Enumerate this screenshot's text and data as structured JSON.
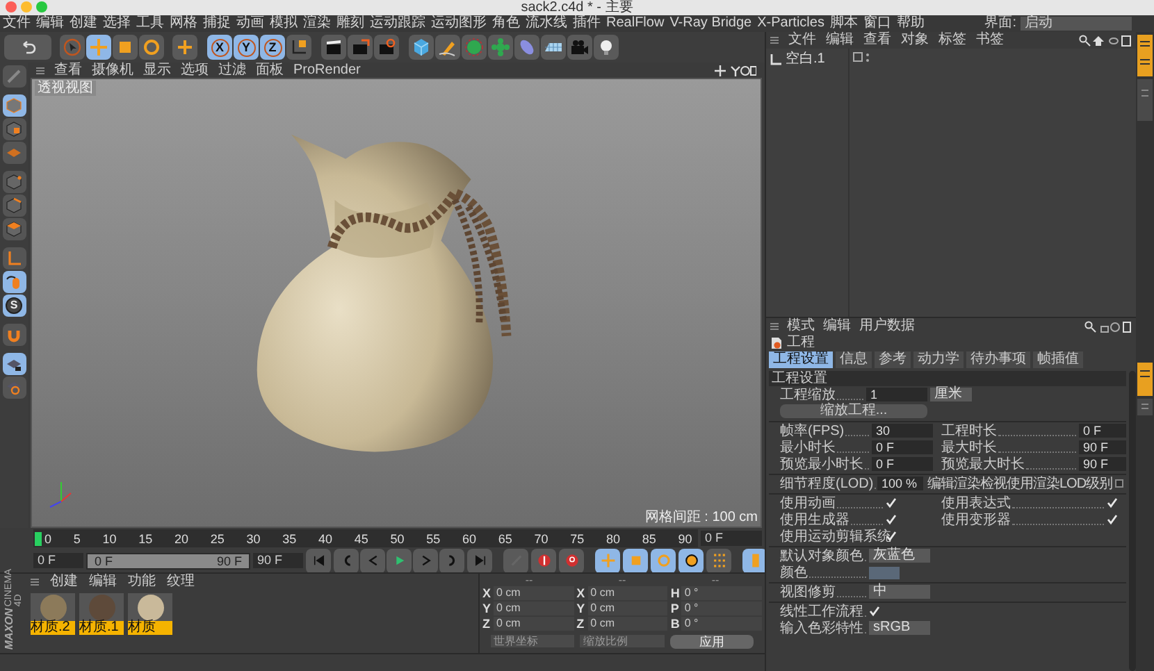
{
  "window": {
    "title": "sack2.c4d * - 主要"
  },
  "menu": [
    "文件",
    "编辑",
    "创建",
    "选择",
    "工具",
    "网格",
    "捕捉",
    "动画",
    "模拟",
    "渲染",
    "雕刻",
    "运动跟踪",
    "运动图形",
    "角色",
    "流水线",
    "插件",
    "RealFlow",
    "V-Ray Bridge",
    "X-Particles",
    "脚本",
    "窗口",
    "帮助"
  ],
  "layout": {
    "label": "界面:",
    "value": "启动"
  },
  "toolbar": {
    "axis_buttons": [
      {
        "label": "X",
        "selected": true
      },
      {
        "label": "Y",
        "selected": true
      },
      {
        "label": "Z",
        "selected": true
      }
    ]
  },
  "left_toolbar": {
    "snap_label": "S"
  },
  "viewport": {
    "menu": [
      "查看",
      "摄像机",
      "显示",
      "选项",
      "过滤",
      "面板",
      "ProRender"
    ],
    "label": "透视视图",
    "grid_spacing": "网格间距 : 100 cm"
  },
  "timeline": {
    "ticks": [
      "0",
      "5",
      "10",
      "15",
      "20",
      "25",
      "30",
      "35",
      "40",
      "45",
      "50",
      "55",
      "60",
      "65",
      "70",
      "75",
      "80",
      "85",
      "90"
    ],
    "current_frame": "0 F",
    "start": "0 F",
    "range": {
      "start": "0 F",
      "end": "90 F",
      "level": 1
    },
    "end": "90 F"
  },
  "materials": {
    "menu": [
      "创建",
      "编辑",
      "功能",
      "纹理"
    ],
    "items": [
      {
        "name": "材质.2",
        "color": "#8c7a5a"
      },
      {
        "name": "材质.1",
        "color": "#5e4a3a"
      },
      {
        "name": "材质",
        "color": "#c9b99a"
      }
    ]
  },
  "brand": [
    "MAXON",
    "CINEMA 4D"
  ],
  "coordinates": {
    "headers": [
      "--",
      "--",
      "--"
    ],
    "columns": [
      [
        {
          "label": "X",
          "value": "0 cm"
        },
        {
          "label": "Y",
          "value": "0 cm"
        },
        {
          "label": "Z",
          "value": "0 cm"
        }
      ],
      [
        {
          "label": "X",
          "value": "0 cm"
        },
        {
          "label": "Y",
          "value": "0 cm"
        },
        {
          "label": "Z",
          "value": "0 cm"
        }
      ],
      [
        {
          "label": "H",
          "value": "0 °"
        },
        {
          "label": "P",
          "value": "0 °"
        },
        {
          "label": "B",
          "value": "0 °"
        }
      ]
    ],
    "space": "世界坐标",
    "scale": "缩放比例",
    "apply": "应用"
  },
  "objects": {
    "menu": [
      "文件",
      "编辑",
      "查看",
      "对象",
      "标签",
      "书签"
    ],
    "items": [
      {
        "name": "空白.1"
      }
    ]
  },
  "attributes": {
    "menu": [
      "模式",
      "编辑",
      "用户数据"
    ],
    "object": "工程",
    "tabs": [
      {
        "label": "工程设置",
        "selected": true
      },
      {
        "label": "信息",
        "selected": false
      },
      {
        "label": "参考",
        "selected": false
      },
      {
        "label": "动力学",
        "selected": false
      },
      {
        "label": "待办事项",
        "selected": false
      },
      {
        "label": "帧插值",
        "selected": false
      }
    ],
    "section": "工程设置",
    "scale": {
      "label": "工程缩放",
      "value": "1",
      "unit": "厘米"
    },
    "scale_button": "缩放工程...",
    "fields": [
      {
        "label": "帧率(FPS)",
        "value": "30"
      },
      {
        "label": "工程时长",
        "value": "0 F"
      },
      {
        "label": "最小时长",
        "value": "0 F"
      },
      {
        "label": "最大时长",
        "value": "90 F"
      },
      {
        "label": "预览最小时长",
        "value": "0 F"
      },
      {
        "label": "预览最大时长",
        "value": "90 F"
      }
    ],
    "lod": {
      "label": "细节程度(LOD)",
      "value": "100 %"
    },
    "lod_option": {
      "label": "编辑渲染检视使用渲染LOD级别",
      "checked": false
    },
    "options": [
      {
        "label": "使用动画",
        "checked": true
      },
      {
        "label": "使用表达式",
        "checked": true
      },
      {
        "label": "使用生成器",
        "checked": true
      },
      {
        "label": "使用变形器",
        "checked": true
      },
      {
        "label": "使用运动剪辑系统",
        "checked": true
      }
    ],
    "default_color": {
      "label": "默认对象颜色",
      "value": "灰蓝色"
    },
    "color_label": "颜色",
    "view_clipping": {
      "label": "视图修剪",
      "value": "中"
    },
    "linear_workflow": {
      "label": "线性工作流程",
      "checked": true
    },
    "input_color_profile": {
      "label": "输入色彩特性",
      "value": "sRGB"
    }
  }
}
